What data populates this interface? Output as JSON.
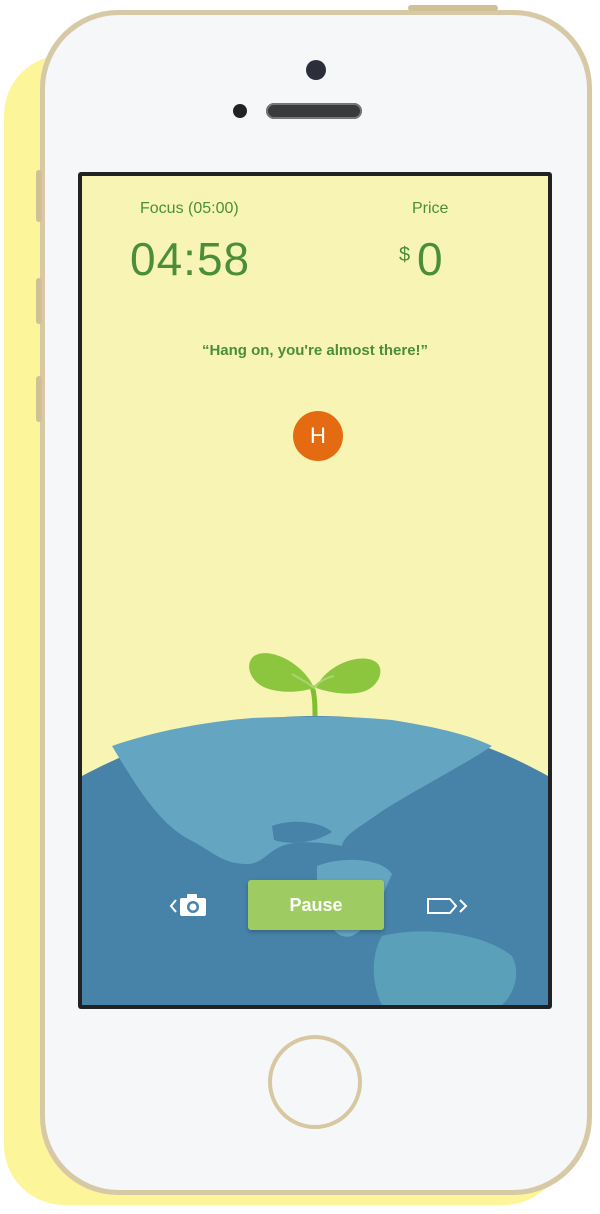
{
  "status": {
    "focus_label": "Focus (05:00)",
    "timer": "04:58",
    "price_label": "Price",
    "currency": "$",
    "price_value": "0"
  },
  "quote": "“Hang on, you're almost there!”",
  "avatar": {
    "initial": "H",
    "color": "#e46b12"
  },
  "controls": {
    "pause_label": "Pause",
    "camera_icon": "camera-icon",
    "tag_icon": "tag-icon"
  },
  "colors": {
    "background": "#f8f5b4",
    "accent_green": "#4a8f38",
    "button_green": "#9fcc62",
    "ocean": "#4783a8",
    "land": "#64a6c1"
  }
}
